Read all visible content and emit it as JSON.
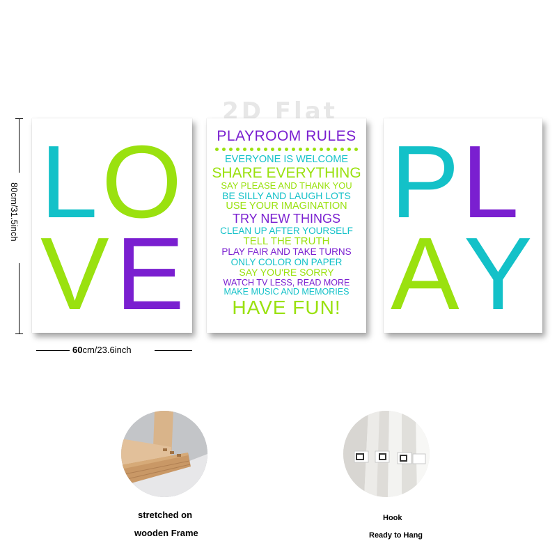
{
  "watermark": "2D Flat",
  "colors": {
    "teal": "#13c1c8",
    "lime": "#9ae10f",
    "purple": "#7a1fd0"
  },
  "left_canvas": {
    "letters": [
      "L",
      "O",
      "V",
      "E"
    ]
  },
  "center_canvas": {
    "title": "PLAYROOM RULES",
    "rules": [
      "EVERYONE IS WELCOME",
      "SHARE EVERYTHING",
      "SAY PLEASE AND THANK YOU",
      "BE SILLY AND LAUGH LOTS",
      "USE YOUR IMAGINATION",
      "TRY NEW THINGS",
      "CLEAN UP AFTER YOURSELF",
      "TELL THE TRUTH",
      "PLAY FAIR AND TAKE TURNS",
      "ONLY COLOR ON PAPER",
      "SAY YOU'RE SORRY",
      "WATCH TV LESS, READ MORE",
      "MAKE MUSIC AND MEMORIES"
    ],
    "footer": "HAVE FUN!"
  },
  "right_canvas": {
    "letters": [
      "P",
      "L",
      "A",
      "Y"
    ]
  },
  "dimensions": {
    "height": "80cm/31.5inch",
    "width_cm": "60",
    "width_rest": "cm/23.6inch"
  },
  "features": [
    {
      "icon": "wooden-frame-photo",
      "caption_lines": [
        "stretched on",
        "wooden Frame"
      ]
    },
    {
      "icon": "hook-photo",
      "caption_lines": [
        "Hook",
        "Ready to Hang"
      ]
    }
  ]
}
